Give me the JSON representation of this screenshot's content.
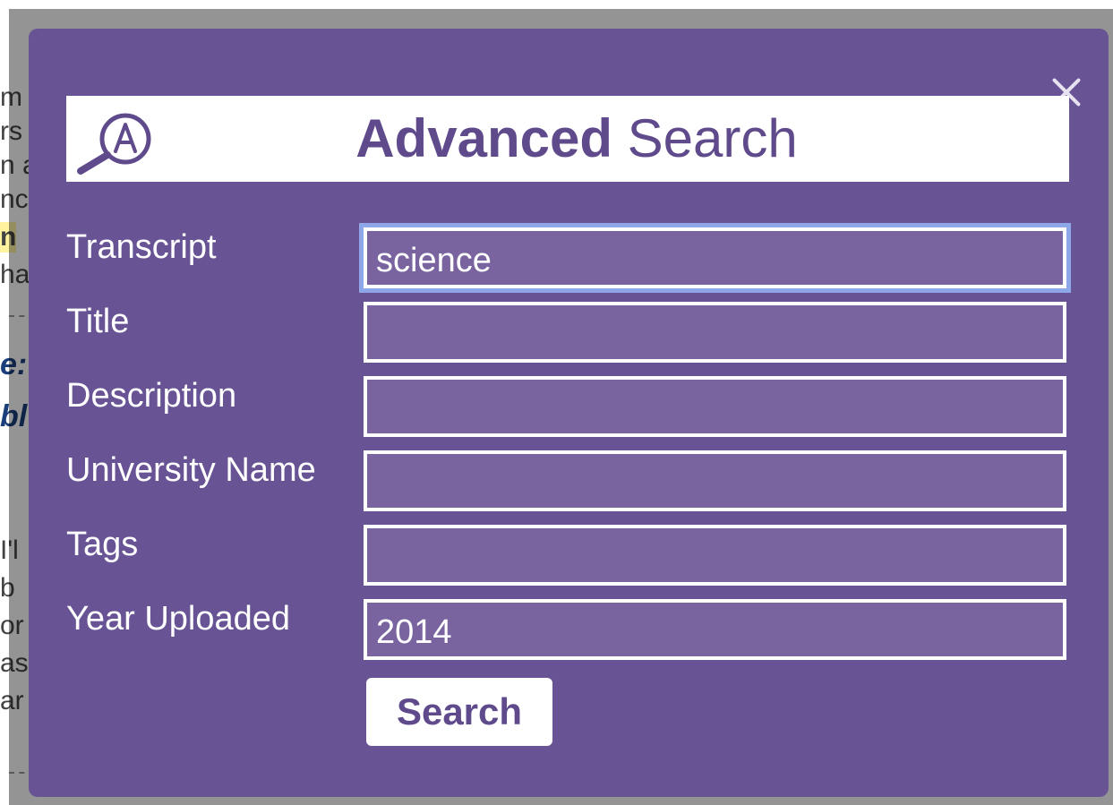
{
  "background_page": {
    "fragments": [
      "m",
      "rs",
      "n a",
      "nc",
      "n",
      "ha",
      "e:",
      "bl",
      "I'l",
      "b",
      "or",
      "as",
      "ar"
    ]
  },
  "modal": {
    "title_bold": "Advanced",
    "title_regular": "Search",
    "logo_icon": "magnifier-letter-a-icon",
    "close_icon": "close-x-icon",
    "fields": [
      {
        "label": "Transcript",
        "value": "science"
      },
      {
        "label": "Title",
        "value": ""
      },
      {
        "label": "Description",
        "value": ""
      },
      {
        "label": "University Name",
        "value": ""
      },
      {
        "label": "Tags",
        "value": ""
      },
      {
        "label": "Year Uploaded",
        "value": "2014"
      }
    ],
    "submit_label": "Search"
  },
  "colors": {
    "modal_bg": "#685495",
    "input_bg": "#7964a0",
    "accent_text": "#5f4a8c",
    "focus_ring": "#8ea7e8"
  }
}
